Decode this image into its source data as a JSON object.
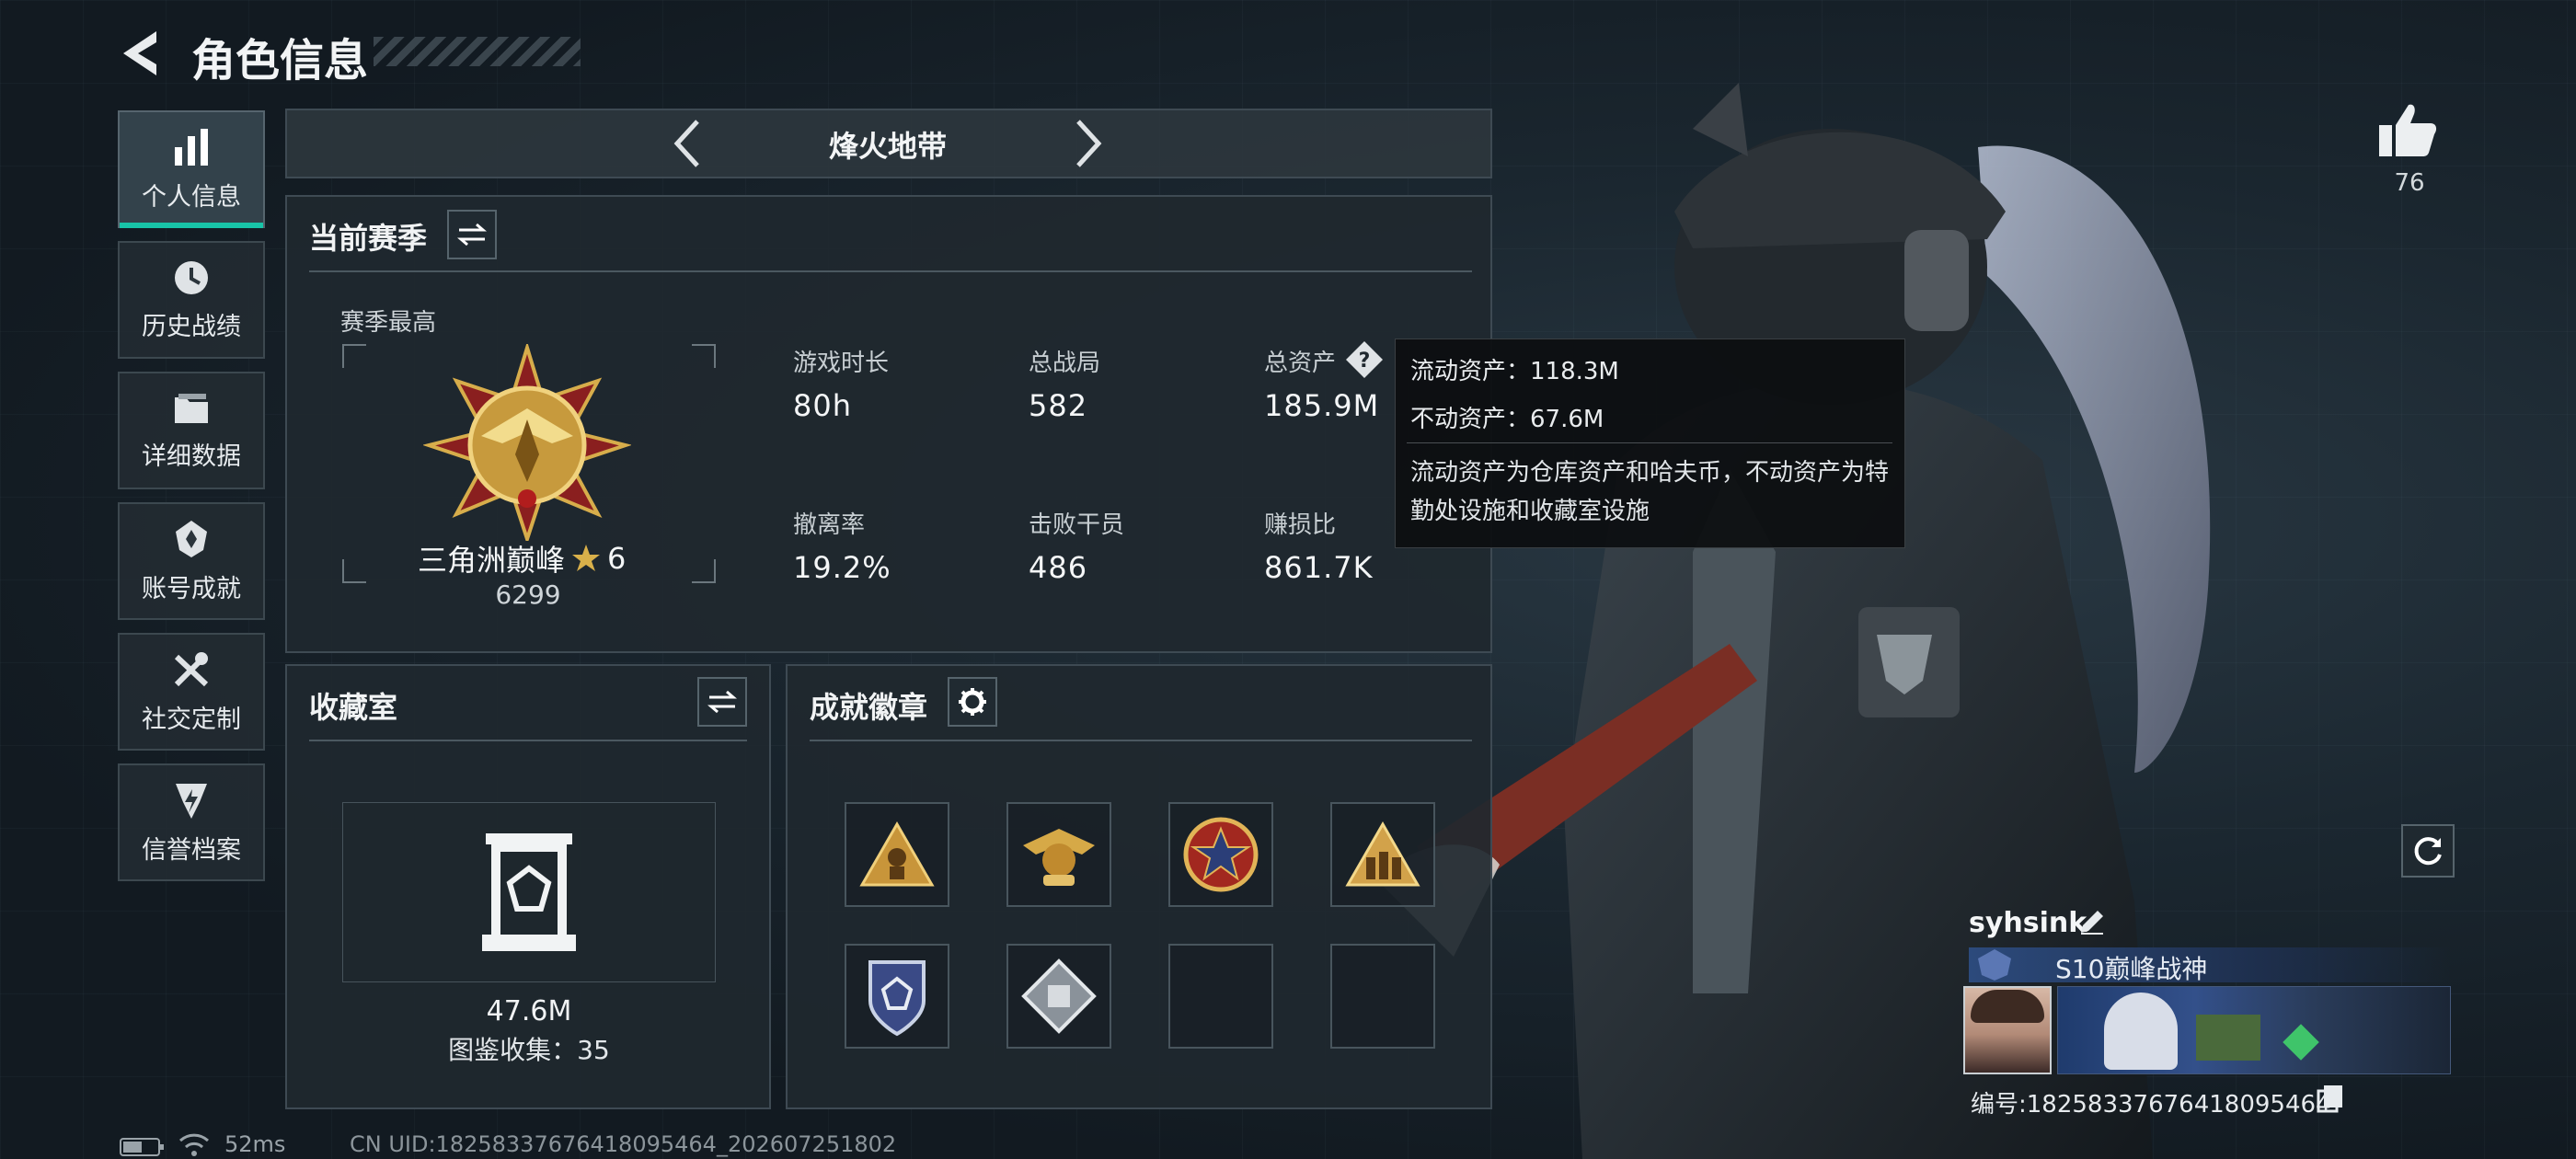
{
  "header": {
    "title": "角色信息"
  },
  "nav": [
    {
      "label": "个人信息",
      "icon": "bar-chart-icon",
      "active": true
    },
    {
      "label": "历史战绩",
      "icon": "history-clock-icon"
    },
    {
      "label": "详细数据",
      "icon": "folder-icon"
    },
    {
      "label": "账号成就",
      "icon": "achievement-icon"
    },
    {
      "label": "社交定制",
      "icon": "tools-icon"
    },
    {
      "label": "信誉档案",
      "icon": "credit-shield-icon"
    }
  ],
  "mode_selector": {
    "label": "烽火地带"
  },
  "season": {
    "title": "当前赛季",
    "best_label": "赛季最高",
    "rank_name": "三角洲巅峰",
    "rank_stars": "6",
    "rank_points": "6299",
    "stats": [
      {
        "label": "游戏时长",
        "value": "80h"
      },
      {
        "label": "总战局",
        "value": "582"
      },
      {
        "label": "总资产",
        "value": "185.9M"
      },
      {
        "label": "撤离率",
        "value": "19.2%"
      },
      {
        "label": "击败干员",
        "value": "486"
      },
      {
        "label": "赚损比",
        "value": "861.7K"
      }
    ],
    "help_glyph": "?"
  },
  "tooltip": {
    "liquid": "流动资产：118.3M",
    "fixed": "不动资产：67.6M",
    "note": "流动资产为仓库资产和哈夫币，不动资产为特勤处设施和收藏室设施"
  },
  "collection": {
    "title": "收藏室",
    "value": "47.6M",
    "count_text": "图鉴收集：35"
  },
  "badges": {
    "title": "成就徽章",
    "slots": [
      {
        "icon": "triangle-soldier-badge-icon"
      },
      {
        "icon": "golden-eagle-badge-icon"
      },
      {
        "icon": "star-medal-badge-icon"
      },
      {
        "icon": "triangle-squad-badge-icon"
      },
      {
        "icon": "shield-emblem-badge-icon"
      },
      {
        "icon": "diamond-crate-badge-icon"
      },
      {
        "icon": ""
      },
      {
        "icon": ""
      }
    ]
  },
  "likes": {
    "count": "76"
  },
  "profile": {
    "name": "syhsink",
    "title_badge": "S10巅峰战神",
    "id_text": "编号:18258337676418095464"
  },
  "status_bar": {
    "ping": "52ms",
    "uid": "CN UID:18258337676418095464_202607251802"
  },
  "colors": {
    "accent": "#18c4a8",
    "gold": "#d8b04a",
    "panel": "#1f282f"
  }
}
